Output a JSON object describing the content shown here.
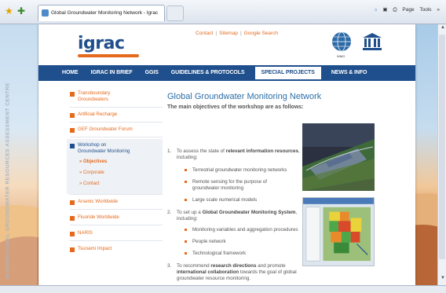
{
  "browser": {
    "tab_title": "Global Groundwater Monitoring Network - Igrac",
    "toolbar_items": [
      "Page",
      "Tools"
    ],
    "toolbar_separators": [
      "»"
    ]
  },
  "site": {
    "logo": "igrac",
    "top_links": [
      "Contact",
      "Sitemap",
      "Google Search"
    ],
    "emblem_caption": "WMO",
    "side_label": "INTERNATIONAL GROUNDWATER RESOURCES ASSESSMENT CENTRE",
    "nav": [
      "HOME",
      "IGRAC IN BRIEF",
      "GGIS",
      "GUIDELINES & PROTOCOLS",
      "SPECIAL PROJECTS",
      "NEWS & INFO"
    ],
    "active_nav": "SPECIAL PROJECTS"
  },
  "sidebar": {
    "items": [
      "Transboundary Groundwaters",
      "Artificial Recharge",
      "GEF Groundwater Forum",
      "Workshop on Groundwater Monitoring",
      "Arsenic Worldwide",
      "Fluoride Worldwide",
      "NARIS",
      "Tsunami Impact"
    ],
    "sub_items": [
      "Objectives",
      "Corporate",
      "Contact"
    ]
  },
  "content": {
    "title": "Global Groundwater Monitoring Network",
    "intro": "The main objectives of the workshop are as follows:",
    "objectives": [
      {
        "num": "1.",
        "text_pre": "To assess the state of ",
        "text_bold": "relevant information resources",
        "text_post": ", including:",
        "bullets": [
          "Terrestrial groundwater monitoring networks",
          "Remote sensing for the purpose of groundwater monitoring",
          "Large scale numerical models"
        ]
      },
      {
        "num": "2.",
        "text_pre": "To set up a ",
        "text_bold": "Global Groundwater Monitoring System",
        "text_post": ", including:",
        "bullets": [
          "Monitoring variables and aggregation procedures",
          "People network",
          "Technological framework"
        ]
      },
      {
        "num": "3.",
        "text_pre": "To recommend ",
        "text_bold": "research directions",
        "text_mid": " and promote ",
        "text_bold2": "international collaboration",
        "text_post": " towards the goal of global groundwater resource monitoring."
      }
    ]
  },
  "colors": {
    "brand_blue": "#1f4f8c",
    "accent_orange": "#e56a1c",
    "title_blue": "#2c6ea8"
  }
}
